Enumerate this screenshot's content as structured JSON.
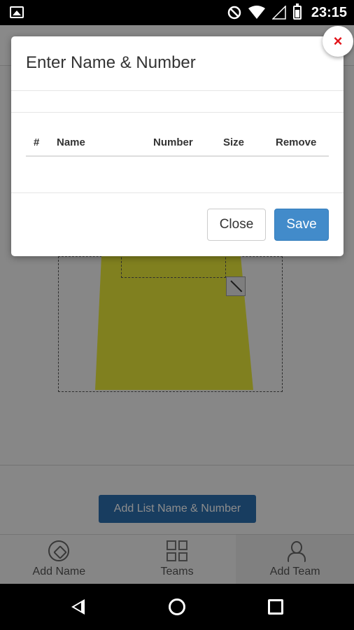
{
  "status_bar": {
    "time": "23:15",
    "icons": [
      "image-notification-icon",
      "do-not-disturb-icon",
      "wifi-icon",
      "cell-signal-icon",
      "battery-icon"
    ]
  },
  "app": {
    "add_list_button": "Add List Name & Number",
    "bottom_nav": [
      {
        "label": "Add Name",
        "icon": "soccer-ball-icon"
      },
      {
        "label": "Teams",
        "icon": "grid-icon"
      },
      {
        "label": "Add Team",
        "icon": "person-icon"
      }
    ]
  },
  "modal": {
    "title": "Enter Name & Number",
    "close_icon": "×",
    "table": {
      "headers": [
        "#",
        "Name",
        "Number",
        "Size",
        "Remove"
      ],
      "rows": []
    },
    "buttons": {
      "close": "Close",
      "save": "Save"
    }
  },
  "colors": {
    "save_button": "#428bca",
    "add_list_button": "#2d6fb0",
    "shirt": "#eaea3a",
    "close_x": "#e2141a"
  }
}
